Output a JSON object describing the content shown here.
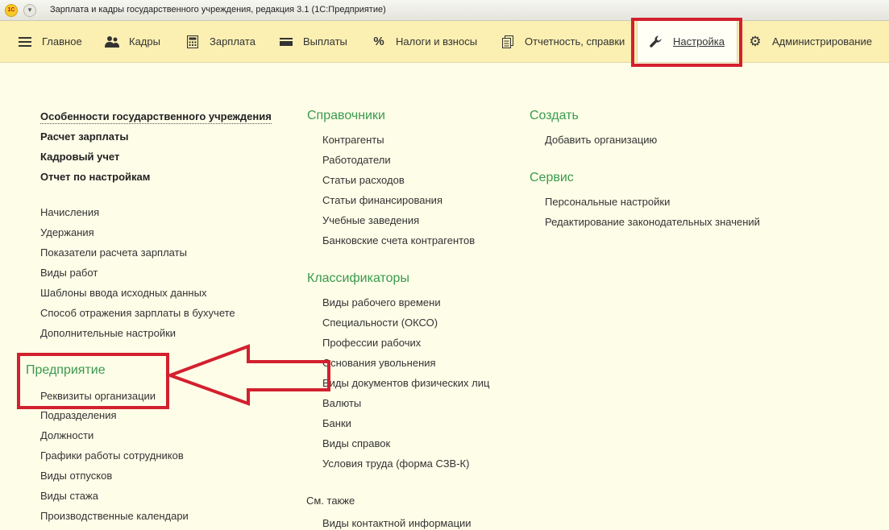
{
  "window": {
    "title": "Зарплата и кадры государственного учреждения, редакция 3.1  (1С:Предприятие)",
    "logo_text": "1С"
  },
  "nav": [
    {
      "label": "Главное",
      "icon": "hamburger-icon"
    },
    {
      "label": "Кадры",
      "icon": "people-icon"
    },
    {
      "label": "Зарплата",
      "icon": "calculator-icon"
    },
    {
      "label": "Выплаты",
      "icon": "wallet-icon"
    },
    {
      "label": "Налоги и взносы",
      "icon": "percent-icon"
    },
    {
      "label": "Отчетность, справки",
      "icon": "documents-icon"
    },
    {
      "label": "Настройка",
      "icon": "wrench-icon",
      "active": true
    },
    {
      "label": "Администрирование",
      "icon": "gear-icon"
    }
  ],
  "col1": {
    "bold_items": [
      "Особенности государственного учреждения",
      "Расчет зарплаты",
      "Кадровый учет",
      "Отчет по настройкам"
    ],
    "items": [
      "Начисления",
      "Удержания",
      "Показатели расчета зарплаты",
      "Виды работ",
      "Шаблоны ввода исходных данных",
      "Способ отражения зарплаты в бухучете",
      "Дополнительные настройки"
    ],
    "section_enterprise": "Предприятие",
    "enterprise_items": [
      "Реквизиты организации",
      "Подразделения",
      "Должности",
      "Графики работы сотрудников",
      "Виды отпусков",
      "Виды стажа",
      "Производственные календари"
    ]
  },
  "col2": {
    "section_refs": "Справочники",
    "refs_items": [
      "Контрагенты",
      "Работодатели",
      "Статьи расходов",
      "Статьи финансирования",
      "Учебные заведения",
      "Банковские счета контрагентов"
    ],
    "section_class": "Классификаторы",
    "class_items": [
      "Виды рабочего времени",
      "Специальности (ОКСО)",
      "Профессии рабочих",
      "Основания увольнения",
      "Виды документов физических лиц",
      "Валюты",
      "Банки",
      "Виды справок",
      "Условия труда (форма СЗВ-К)"
    ],
    "see_also": "См. также",
    "see_also_items": [
      "Виды контактной информации"
    ]
  },
  "col3": {
    "section_create": "Создать",
    "create_items": [
      "Добавить организацию"
    ],
    "section_service": "Сервис",
    "service_items": [
      "Персональные настройки",
      "Редактирование законодательных значений"
    ]
  },
  "colors": {
    "navbar": "#fbefb2",
    "content_bg": "#fefde8",
    "section_green": "#3a9a4e",
    "highlight_red": "#d3202e"
  }
}
